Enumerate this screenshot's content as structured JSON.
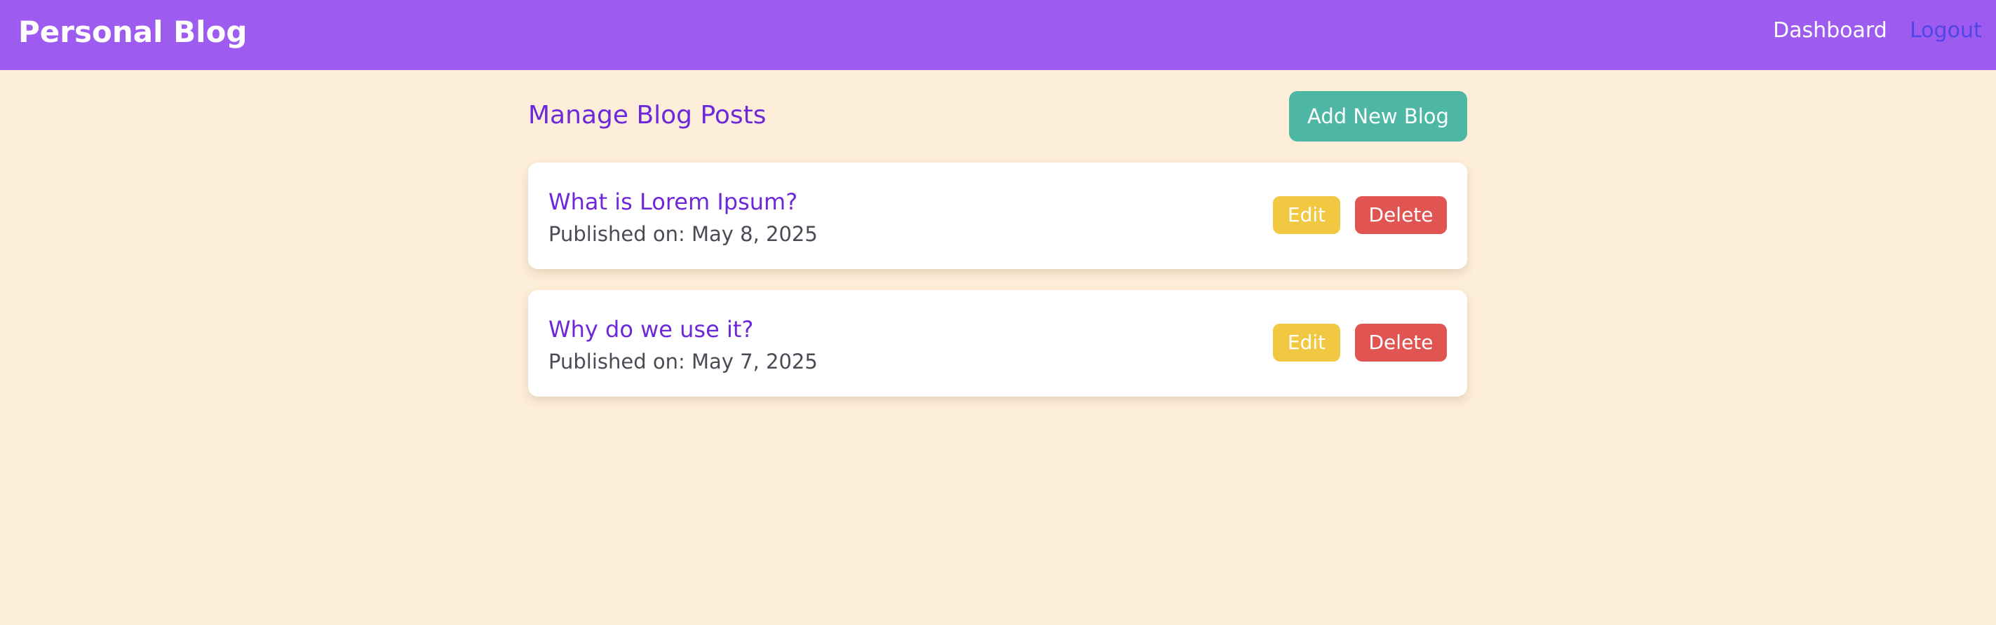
{
  "navbar": {
    "brand": "Personal Blog",
    "links": [
      {
        "label": "Dashboard"
      },
      {
        "label": "Logout"
      }
    ]
  },
  "main": {
    "title": "Manage Blog Posts",
    "add_button_label": "Add New Blog",
    "posts": [
      {
        "title": "What is Lorem Ipsum?",
        "published": "Published on: May 8, 2025",
        "edit_label": "Edit",
        "delete_label": "Delete"
      },
      {
        "title": "Why do we use it?",
        "published": "Published on: May 7, 2025",
        "edit_label": "Edit",
        "delete_label": "Delete"
      }
    ]
  },
  "colors": {
    "navbar": "#9d5cef",
    "background": "#fdeed9",
    "accent_text": "#6d28d9",
    "add_button": "#4db6a5",
    "edit_button": "#f1c842",
    "delete_button": "#e05452",
    "logout_link": "#4f46e5"
  }
}
